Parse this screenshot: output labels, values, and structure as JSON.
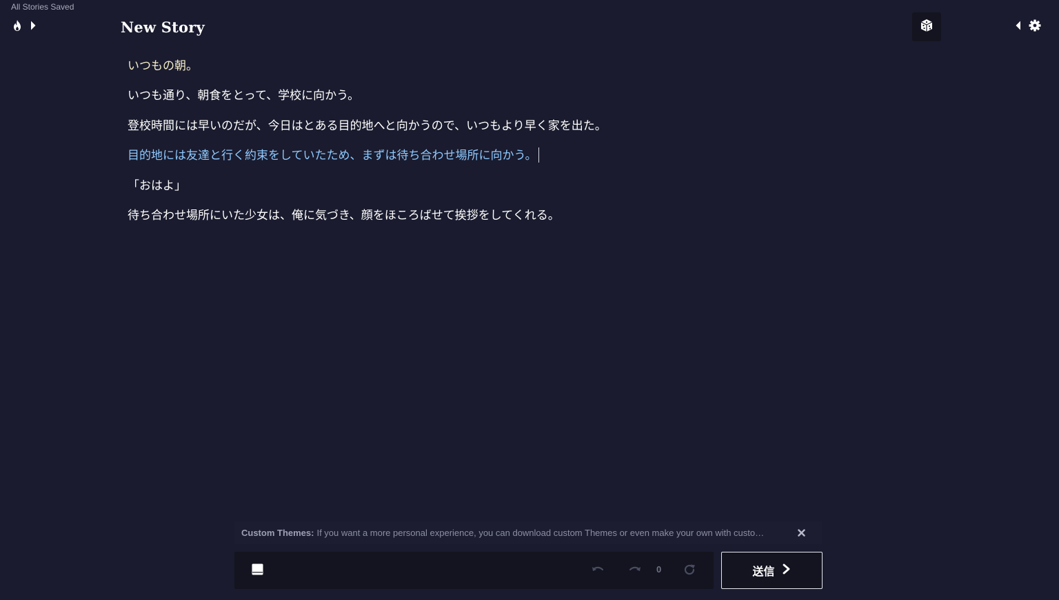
{
  "header": {
    "saved_status": "All Stories Saved",
    "title": "New Story",
    "left_icons": [
      "fire-icon",
      "chevron-right-icon"
    ],
    "right_icons": [
      "dice-icon",
      "chevron-left-icon",
      "gear-icon"
    ]
  },
  "story": {
    "paragraphs": [
      {
        "type": "prompt",
        "text": "いつもの朝。"
      },
      {
        "type": "ai",
        "text": "いつも通り、朝食をとって、学校に向かう。"
      },
      {
        "type": "ai",
        "text": "登校時間には早いのだが、今日はとある目的地へと向かうので、いつもより早く家を出た。"
      },
      {
        "type": "edit",
        "text": "目的地には友達と行く約束をしていたため、まずは待ち合わせ場所に向かう。"
      },
      {
        "type": "ai",
        "text": "「おはよ」"
      },
      {
        "type": "ai",
        "text": "待ち合わせ場所にいた少女は、俺に気づき、顔をほころばせて挨拶をしてくれる。"
      }
    ]
  },
  "tip": {
    "label": "Custom Themes:",
    "text": "If you want a more personal experience, you can download custom Themes or even make your own with custo…"
  },
  "input": {
    "step_count": "0",
    "send_label": "送信"
  },
  "colors": {
    "background": "#1a1b2e",
    "panel": "#13141f",
    "prompt_text": "#f4ecc6",
    "ai_text": "#ffffff",
    "edit_text": "#8ec9ff"
  }
}
